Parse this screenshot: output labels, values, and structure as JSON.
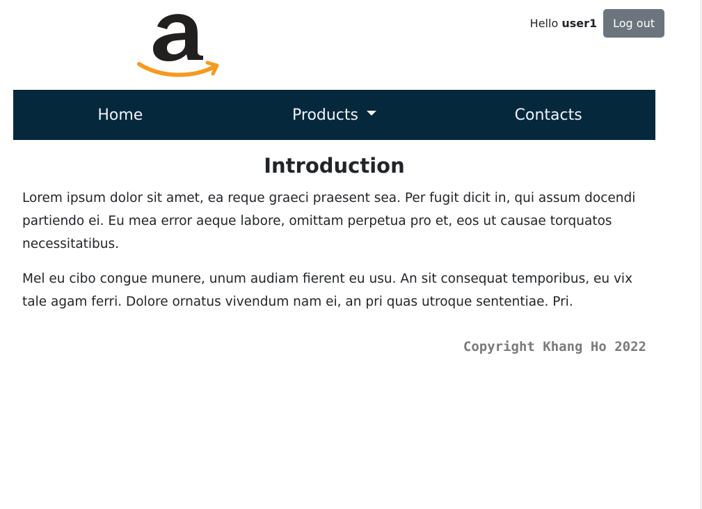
{
  "header": {
    "logo_icon": "amazon-logo",
    "hello_prefix": "Hello",
    "username": "user1",
    "logout_label": "Log out"
  },
  "nav": {
    "items": [
      {
        "label": "Home"
      },
      {
        "label": "Products",
        "icon": "caret-down-icon"
      },
      {
        "label": "Contacts"
      }
    ]
  },
  "main": {
    "title": "Introduction",
    "paragraphs": [
      "Lorem ipsum dolor sit amet, ea reque graeci praesent sea. Per fugit dicit in, qui assum docendi partiendo ei. Eu mea error aeque labore, omittam perpetua pro et, eos ut causae torquatos necessitatibus.",
      "Mel eu cibo congue munere, unum audiam fierent eu usu. An sit consequat temporibus, eu vix tale agam ferri. Dolore ornatus vivendum nam ei, an pri quas utroque sententiae. Pri."
    ]
  },
  "footer": {
    "copyright": "Copyright Khang Ho 2022"
  },
  "colors": {
    "navbar": "#05283d",
    "logout_button": "#6c757d",
    "logo_orange": "#f79a1e",
    "logo_dark": "#221f1f"
  }
}
